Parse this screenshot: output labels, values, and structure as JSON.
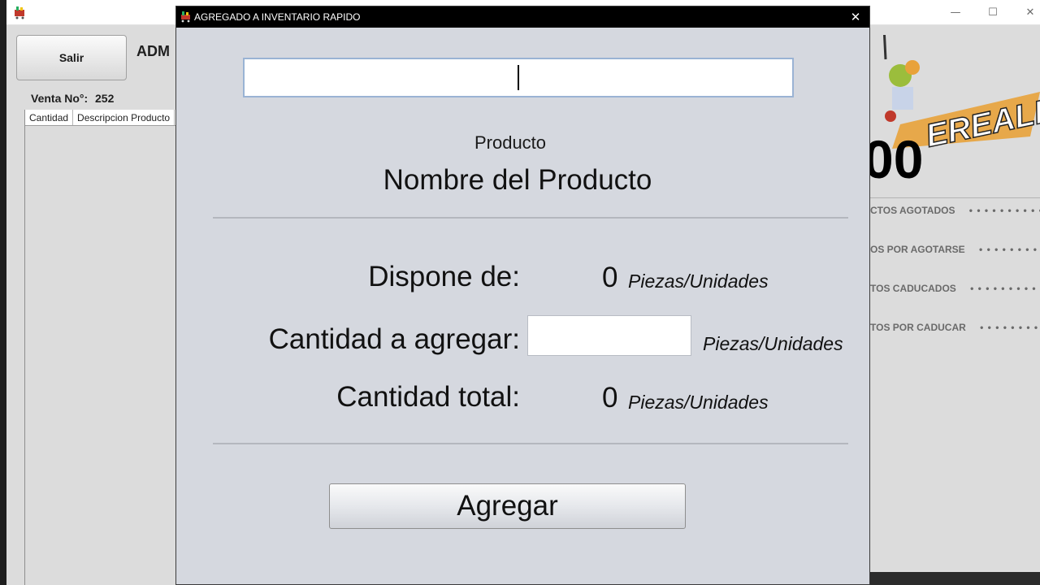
{
  "main_window": {
    "admin_title": "ADM",
    "salir_label": "Salir",
    "venta_label": "Venta No°:",
    "venta_number": "252",
    "table_headers": [
      "Cantidad",
      "Descripcion Producto"
    ],
    "logo_text": "EREALES",
    "logo_number": "00",
    "alerts": [
      "CTOS AGOTADOS",
      "OS POR AGOTARSE",
      "TOS CADUCADOS",
      "TOS POR CADUCAR"
    ],
    "alert_dots": "• • • • • • • • • • • •"
  },
  "dialog": {
    "title": "AGREGADO A INVENTARIO RAPIDO",
    "search_value": "",
    "product_label": "Producto",
    "product_name": "Nombre del Producto",
    "dispone_label": "Dispone de:",
    "dispone_value": "0",
    "cantidad_label": "Cantidad a agregar:",
    "cantidad_value": "",
    "total_label": "Cantidad total:",
    "total_value": "0",
    "unit_label": "Piezas/Unidades",
    "agregar_label": "Agregar"
  },
  "icons": {
    "app": "cart-icon",
    "close": "close-icon",
    "minimize": "minimize-icon",
    "maximize": "maximize-icon"
  },
  "colors": {
    "dialog_background": "#d5d8df",
    "dialog_titlebar": "#000000",
    "main_background": "#dcdcdc",
    "logo_accent": "#e8a23a"
  }
}
